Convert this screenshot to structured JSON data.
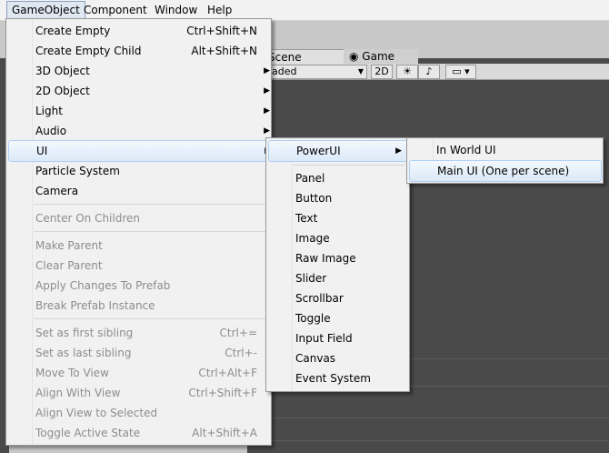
{
  "menubar": {
    "items": [
      "GameObject",
      "Component",
      "Window",
      "Help"
    ]
  },
  "tabs": {
    "scene": "Scene",
    "game": "Game"
  },
  "toolbar": {
    "shading_suffix": "aded",
    "mode_2d": "2D"
  },
  "gameobject_menu": {
    "items": [
      {
        "label": "Create Empty",
        "shortcut": "Ctrl+Shift+N"
      },
      {
        "label": "Create Empty Child",
        "shortcut": "Alt+Shift+N"
      },
      {
        "label": "3D Object",
        "submenu": true
      },
      {
        "label": "2D Object",
        "submenu": true
      },
      {
        "label": "Light",
        "submenu": true
      },
      {
        "label": "Audio",
        "submenu": true
      },
      {
        "label": "UI",
        "submenu": true,
        "highlighted": true
      },
      {
        "label": "Particle System"
      },
      {
        "label": "Camera"
      },
      {
        "label": "Center On Children",
        "disabled": true
      },
      {
        "label": "Make Parent",
        "disabled": true
      },
      {
        "label": "Clear Parent",
        "disabled": true
      },
      {
        "label": "Apply Changes To Prefab",
        "disabled": true
      },
      {
        "label": "Break Prefab Instance",
        "disabled": true
      },
      {
        "label": "Set as first sibling",
        "shortcut": "Ctrl+=",
        "disabled": true
      },
      {
        "label": "Set as last sibling",
        "shortcut": "Ctrl+-",
        "disabled": true
      },
      {
        "label": "Move To View",
        "shortcut": "Ctrl+Alt+F",
        "disabled": true
      },
      {
        "label": "Align With View",
        "shortcut": "Ctrl+Shift+F",
        "disabled": true
      },
      {
        "label": "Align View to Selected",
        "disabled": true
      },
      {
        "label": "Toggle Active State",
        "shortcut": "Alt+Shift+A",
        "disabled": true
      }
    ]
  },
  "ui_menu": {
    "items": [
      {
        "label": "PowerUI",
        "submenu": true,
        "highlighted": true
      },
      {
        "label": "Panel"
      },
      {
        "label": "Button"
      },
      {
        "label": "Text"
      },
      {
        "label": "Image"
      },
      {
        "label": "Raw Image"
      },
      {
        "label": "Slider"
      },
      {
        "label": "Scrollbar"
      },
      {
        "label": "Toggle"
      },
      {
        "label": "Input Field"
      },
      {
        "label": "Canvas"
      },
      {
        "label": "Event System"
      }
    ]
  },
  "powerui_menu": {
    "items": [
      {
        "label": "In World UI"
      },
      {
        "label": "Main UI (One per scene)",
        "highlighted": true
      }
    ]
  }
}
